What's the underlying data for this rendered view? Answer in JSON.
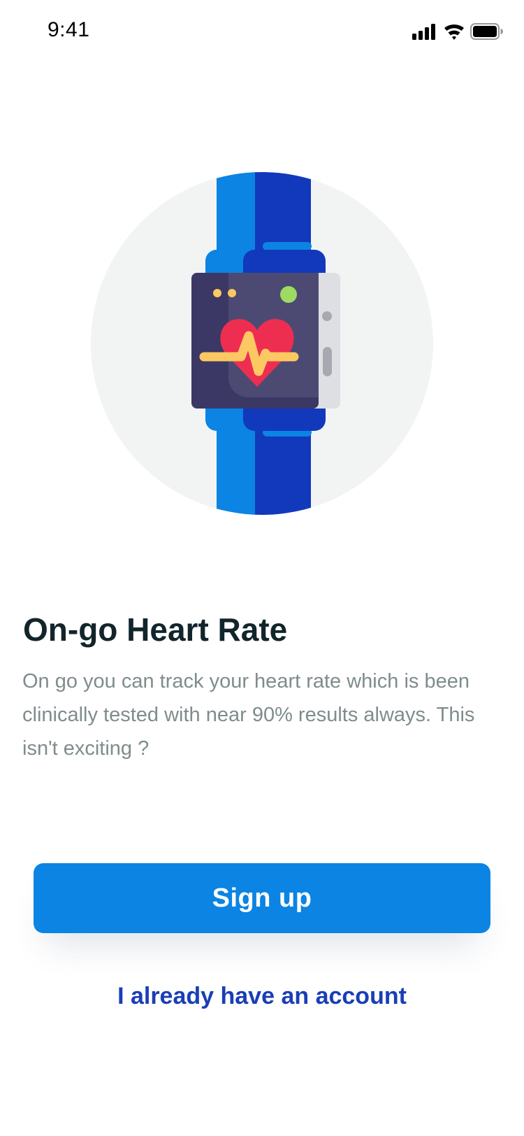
{
  "status_bar": {
    "time": "9:41",
    "icons": [
      "cellular-signal-icon",
      "wifi-icon",
      "battery-icon"
    ]
  },
  "illustration": {
    "icon": "smartwatch-heart-rate-icon",
    "colors": {
      "circle_bg": "#f2f3f3",
      "strap_light": "#0b84e3",
      "strap_dark": "#1239bc",
      "screen_dark": "#3b3866",
      "screen_light": "#4c4a72",
      "bezel": "#dedfe3",
      "heart": "#ee2e50",
      "pulse": "#fcc862",
      "dot_green": "#9ddb63",
      "dot_yellow": "#fcc862"
    }
  },
  "onboarding": {
    "title": "On-go Heart Rate",
    "description": "On go you can track your heart rate which is been clinically tested with near 90% results always. This isn't exciting ?"
  },
  "actions": {
    "signup_label": "Sign up",
    "login_link_label": "I already have an account"
  },
  "colors": {
    "primary": "#0b84e3",
    "link": "#1a3eb6",
    "title": "#12252b",
    "body_text": "#7f8c8d"
  }
}
